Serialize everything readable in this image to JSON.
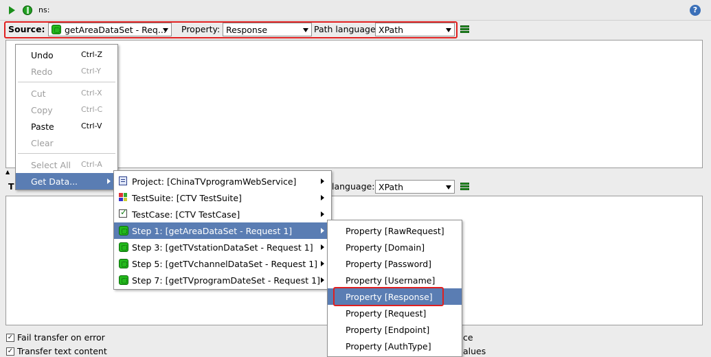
{
  "toolbar": {
    "ns_label": "ns:",
    "run_icon": "play-icon",
    "run_all_icon": "run-all-icon",
    "help_icon": "help-icon",
    "help_glyph": "?"
  },
  "source_row": {
    "source_label": "Source:",
    "source_value": "getAreaDataSet - Req...",
    "property_label": "Property:",
    "property_value": "Response",
    "path_language_label": "Path language:",
    "path_language_value": "XPath"
  },
  "target_row": {
    "label_partial": "T",
    "path_language_label": "language:",
    "path_language_value": "XPath"
  },
  "options": {
    "fail_transfer": "Fail transfer on error",
    "transfer_text": "Transfer text content",
    "right_partial_1": "ce",
    "right_partial_2": "alues"
  },
  "context_menu": {
    "items": [
      {
        "label": "Undo",
        "shortcut": "Ctrl-Z",
        "enabled": true
      },
      {
        "label": "Redo",
        "shortcut": "Ctrl-Y",
        "enabled": false
      },
      {
        "label": "Cut",
        "shortcut": "Ctrl-X",
        "enabled": false
      },
      {
        "label": "Copy",
        "shortcut": "Ctrl-C",
        "enabled": false
      },
      {
        "label": "Paste",
        "shortcut": "Ctrl-V",
        "enabled": true
      },
      {
        "label": "Clear",
        "shortcut": "",
        "enabled": false
      },
      {
        "label": "Select All",
        "shortcut": "Ctrl-A",
        "enabled": false
      },
      {
        "label": "Get Data...",
        "shortcut": "",
        "enabled": true
      }
    ]
  },
  "get_data_menu": {
    "items": [
      {
        "label": "Project: [ChinaTVprogramWebService]",
        "icon": "project-icon"
      },
      {
        "label": "TestSuite: [CTV TestSuite]",
        "icon": "testsuite-icon"
      },
      {
        "label": "TestCase: [CTV TestCase]",
        "icon": "testcase-icon"
      },
      {
        "label": "Step 1: [getAreaDataSet - Request 1]",
        "icon": "test-step-icon"
      },
      {
        "label": "Step 3: [getTVstationDataSet - Request 1]",
        "icon": "test-step-icon"
      },
      {
        "label": "Step 5: [getTVchannelDataSet - Request 1]",
        "icon": "test-step-icon"
      },
      {
        "label": "Step 7: [getTVprogramDateSet - Request 1]",
        "icon": "test-step-icon"
      }
    ]
  },
  "property_menu": {
    "items": [
      "Property [RawRequest]",
      "Property [Domain]",
      "Property [Password]",
      "Property [Username]",
      "Property [Response]",
      "Property [Request]",
      "Property [Endpoint]",
      "Property [AuthType]"
    ]
  },
  "colors": {
    "highlight": "#5a7db3",
    "annotation_red": "#e01f1f",
    "step_green": "#23b81c"
  }
}
